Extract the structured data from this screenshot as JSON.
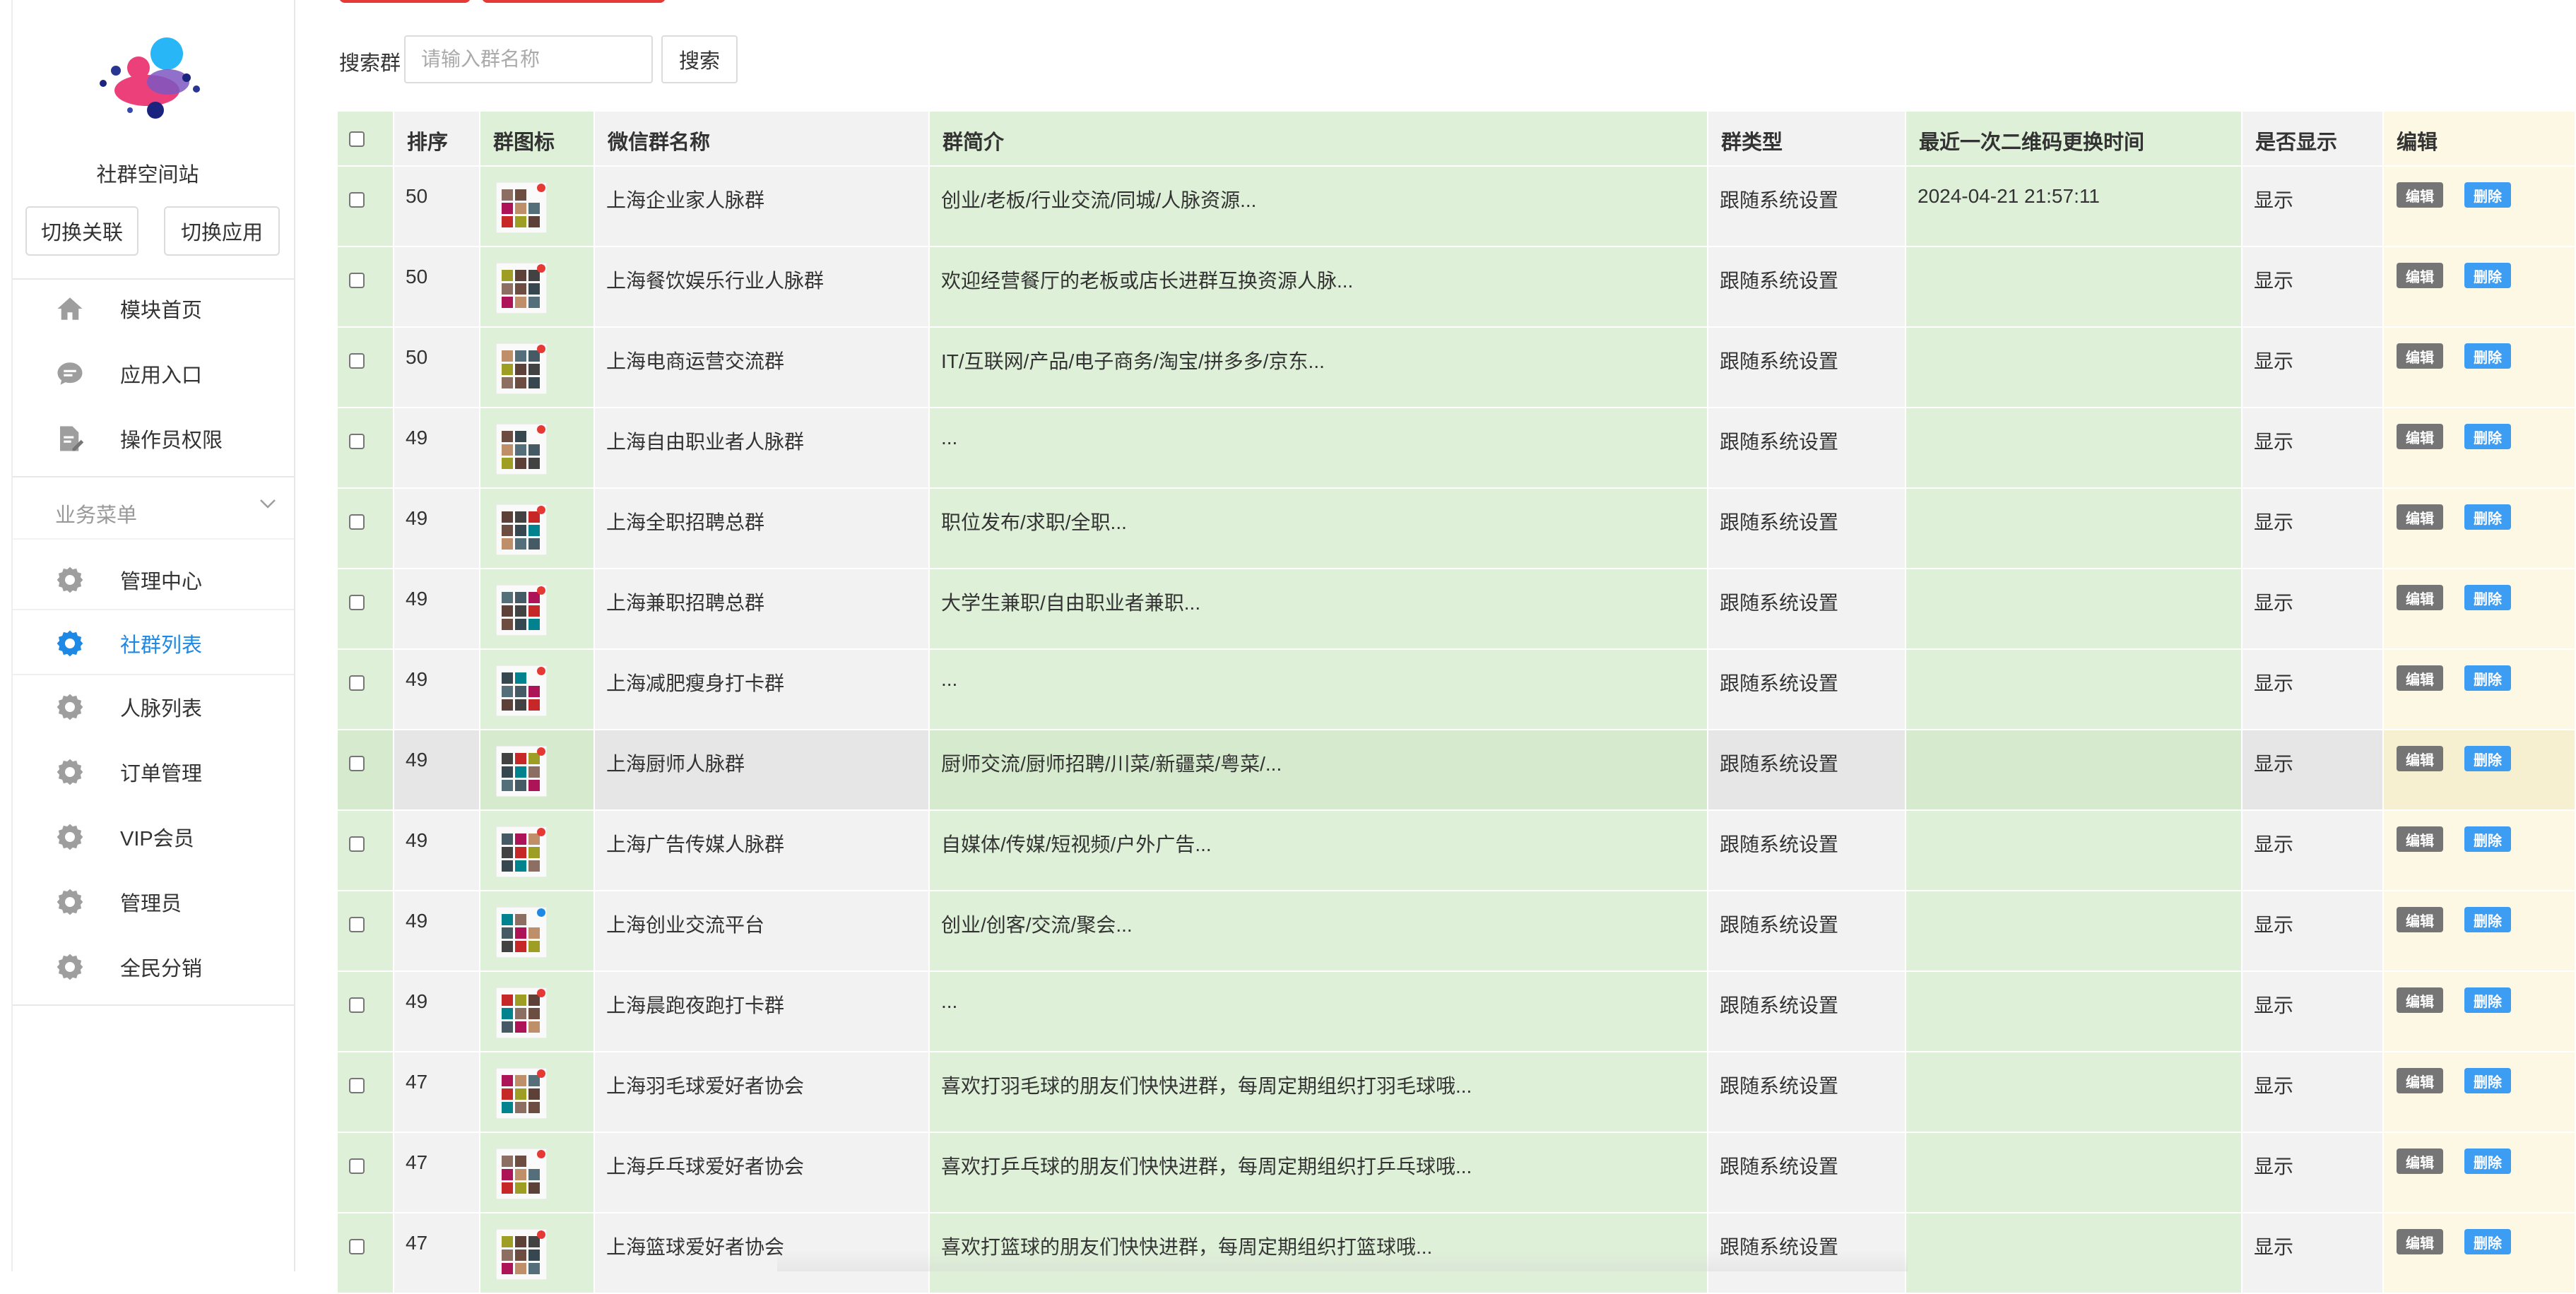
{
  "sidebar": {
    "site_name": "社群空间站",
    "switch_link_label": "切换关联",
    "switch_app_label": "切换应用",
    "top_items": [
      {
        "label": "模块首页",
        "icon": "home-icon"
      },
      {
        "label": "应用入口",
        "icon": "chat-bubble-icon"
      },
      {
        "label": "操作员权限",
        "icon": "document-edit-icon"
      }
    ],
    "section_title": "业务菜单",
    "section_items": [
      {
        "label": "管理中心",
        "icon": "gear-icon",
        "active": false
      },
      {
        "label": "社群列表",
        "icon": "gear-icon",
        "active": true
      },
      {
        "label": "人脉列表",
        "icon": "gear-icon",
        "active": false
      },
      {
        "label": "订单管理",
        "icon": "gear-icon",
        "active": false
      },
      {
        "label": "VIP会员",
        "icon": "gear-icon",
        "active": false
      },
      {
        "label": "管理员",
        "icon": "gear-icon",
        "active": false
      },
      {
        "label": "全民分销",
        "icon": "gear-icon",
        "active": false
      }
    ]
  },
  "search": {
    "label": "搜索群",
    "placeholder": "请输入群名称",
    "button": "搜索"
  },
  "colors": {
    "accent": "#1e88e5",
    "delete_button": "#3d9df3",
    "edit_button": "#757575",
    "top_button": "#e53935",
    "green_column": "#dff0d8",
    "yellow_column": "#fcf8e3",
    "gray_column": "#f2f2f2"
  },
  "table": {
    "headers": [
      "",
      "排序",
      "群图标",
      "微信群名称",
      "群简介",
      "群类型",
      "最近一次二维码更换时间",
      "是否显示",
      "编辑"
    ],
    "edit_label": "编辑",
    "delete_label": "删除",
    "rows": [
      {
        "sort": "50",
        "name": "上海企业家人脉群",
        "intro": "创业/老板/行业交流/同城/人脉资源...",
        "type": "跟随系统设置",
        "qr_time": "2024-04-21 21:57:11",
        "visible": "显示",
        "highlight": false
      },
      {
        "sort": "50",
        "name": "上海餐饮娱乐行业人脉群",
        "intro": "欢迎经营餐厅的老板或店长进群互换资源人脉...",
        "type": "跟随系统设置",
        "qr_time": "",
        "visible": "显示",
        "highlight": false
      },
      {
        "sort": "50",
        "name": "上海电商运营交流群",
        "intro": "IT/互联网/产品/电子商务/淘宝/拼多多/京东...",
        "type": "跟随系统设置",
        "qr_time": "",
        "visible": "显示",
        "highlight": false
      },
      {
        "sort": "49",
        "name": "上海自由职业者人脉群",
        "intro": "...",
        "type": "跟随系统设置",
        "qr_time": "",
        "visible": "显示",
        "highlight": false
      },
      {
        "sort": "49",
        "name": "上海全职招聘总群",
        "intro": "职位发布/求职/全职...",
        "type": "跟随系统设置",
        "qr_time": "",
        "visible": "显示",
        "highlight": false
      },
      {
        "sort": "49",
        "name": "上海兼职招聘总群",
        "intro": "大学生兼职/自由职业者兼职...",
        "type": "跟随系统设置",
        "qr_time": "",
        "visible": "显示",
        "highlight": false
      },
      {
        "sort": "49",
        "name": "上海减肥瘦身打卡群",
        "intro": "...",
        "type": "跟随系统设置",
        "qr_time": "",
        "visible": "显示",
        "highlight": false
      },
      {
        "sort": "49",
        "name": "上海厨师人脉群",
        "intro": "厨师交流/厨师招聘/川菜/新疆菜/粤菜/...",
        "type": "跟随系统设置",
        "qr_time": "",
        "visible": "显示",
        "highlight": true
      },
      {
        "sort": "49",
        "name": "上海广告传媒人脉群",
        "intro": "自媒体/传媒/短视频/户外广告...",
        "type": "跟随系统设置",
        "qr_time": "",
        "visible": "显示",
        "highlight": false
      },
      {
        "sort": "49",
        "name": "上海创业交流平台",
        "intro": "创业/创客/交流/聚会...",
        "type": "跟随系统设置",
        "qr_time": "",
        "visible": "显示",
        "highlight": false
      },
      {
        "sort": "49",
        "name": "上海晨跑夜跑打卡群",
        "intro": "...",
        "type": "跟随系统设置",
        "qr_time": "",
        "visible": "显示",
        "highlight": false
      },
      {
        "sort": "47",
        "name": "上海羽毛球爱好者协会",
        "intro": "喜欢打羽毛球的朋友们快快进群，每周定期组织打羽毛球哦...",
        "type": "跟随系统设置",
        "qr_time": "",
        "visible": "显示",
        "highlight": false
      },
      {
        "sort": "47",
        "name": "上海乒乓球爱好者协会",
        "intro": "喜欢打乒乓球的朋友们快快进群，每周定期组织打乒乓球哦...",
        "type": "跟随系统设置",
        "qr_time": "",
        "visible": "显示",
        "highlight": false
      },
      {
        "sort": "47",
        "name": "上海篮球爱好者协会",
        "intro": "喜欢打篮球的朋友们快快进群，每周定期组织打篮球哦...",
        "type": "跟随系统设置",
        "qr_time": "",
        "visible": "显示",
        "highlight": false
      }
    ]
  }
}
